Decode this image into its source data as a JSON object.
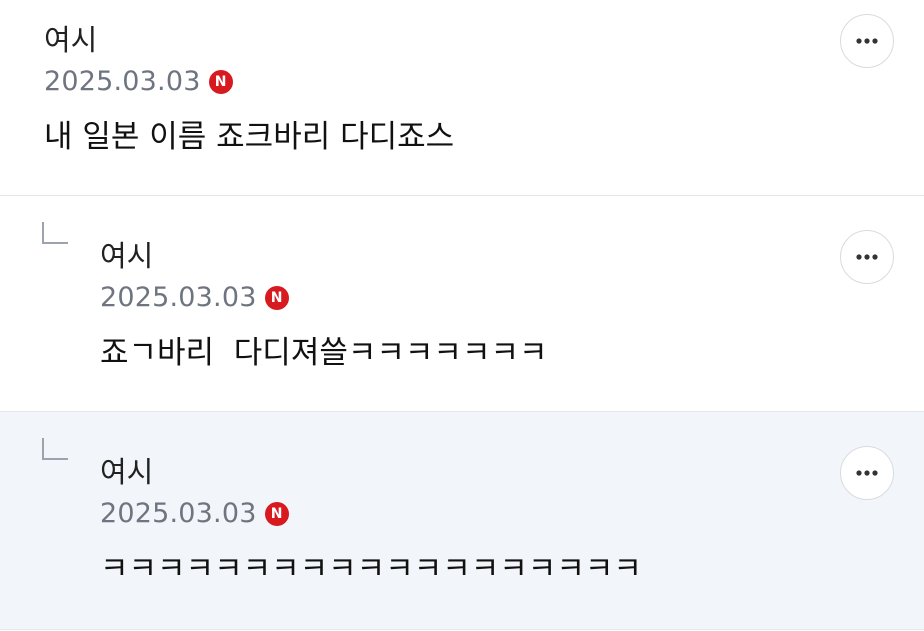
{
  "comments": [
    {
      "author": "여시",
      "date": "2025.03.03",
      "badge": "N",
      "text": "내 일본 이름 죠크바리 다디죠스"
    },
    {
      "author": "여시",
      "date": "2025.03.03",
      "badge": "N",
      "text": "죠ㄱ바리  다디져쓸ㅋㅋㅋㅋㅋㅋㅋ"
    },
    {
      "author": "여시",
      "date": "2025.03.03",
      "badge": "N",
      "text": "ㅋㅋㅋㅋㅋㅋㅋㅋㅋㅋㅋㅋㅋㅋㅋㅋㅋㅋㅋ"
    }
  ],
  "icons": {
    "more": "more-horizontal-icon",
    "reply": "reply-arrow-icon",
    "badge": "naver-n-badge"
  },
  "colors": {
    "badge": "#d71920",
    "date": "#6e7580",
    "highlight_bg": "#f2f5f9"
  }
}
